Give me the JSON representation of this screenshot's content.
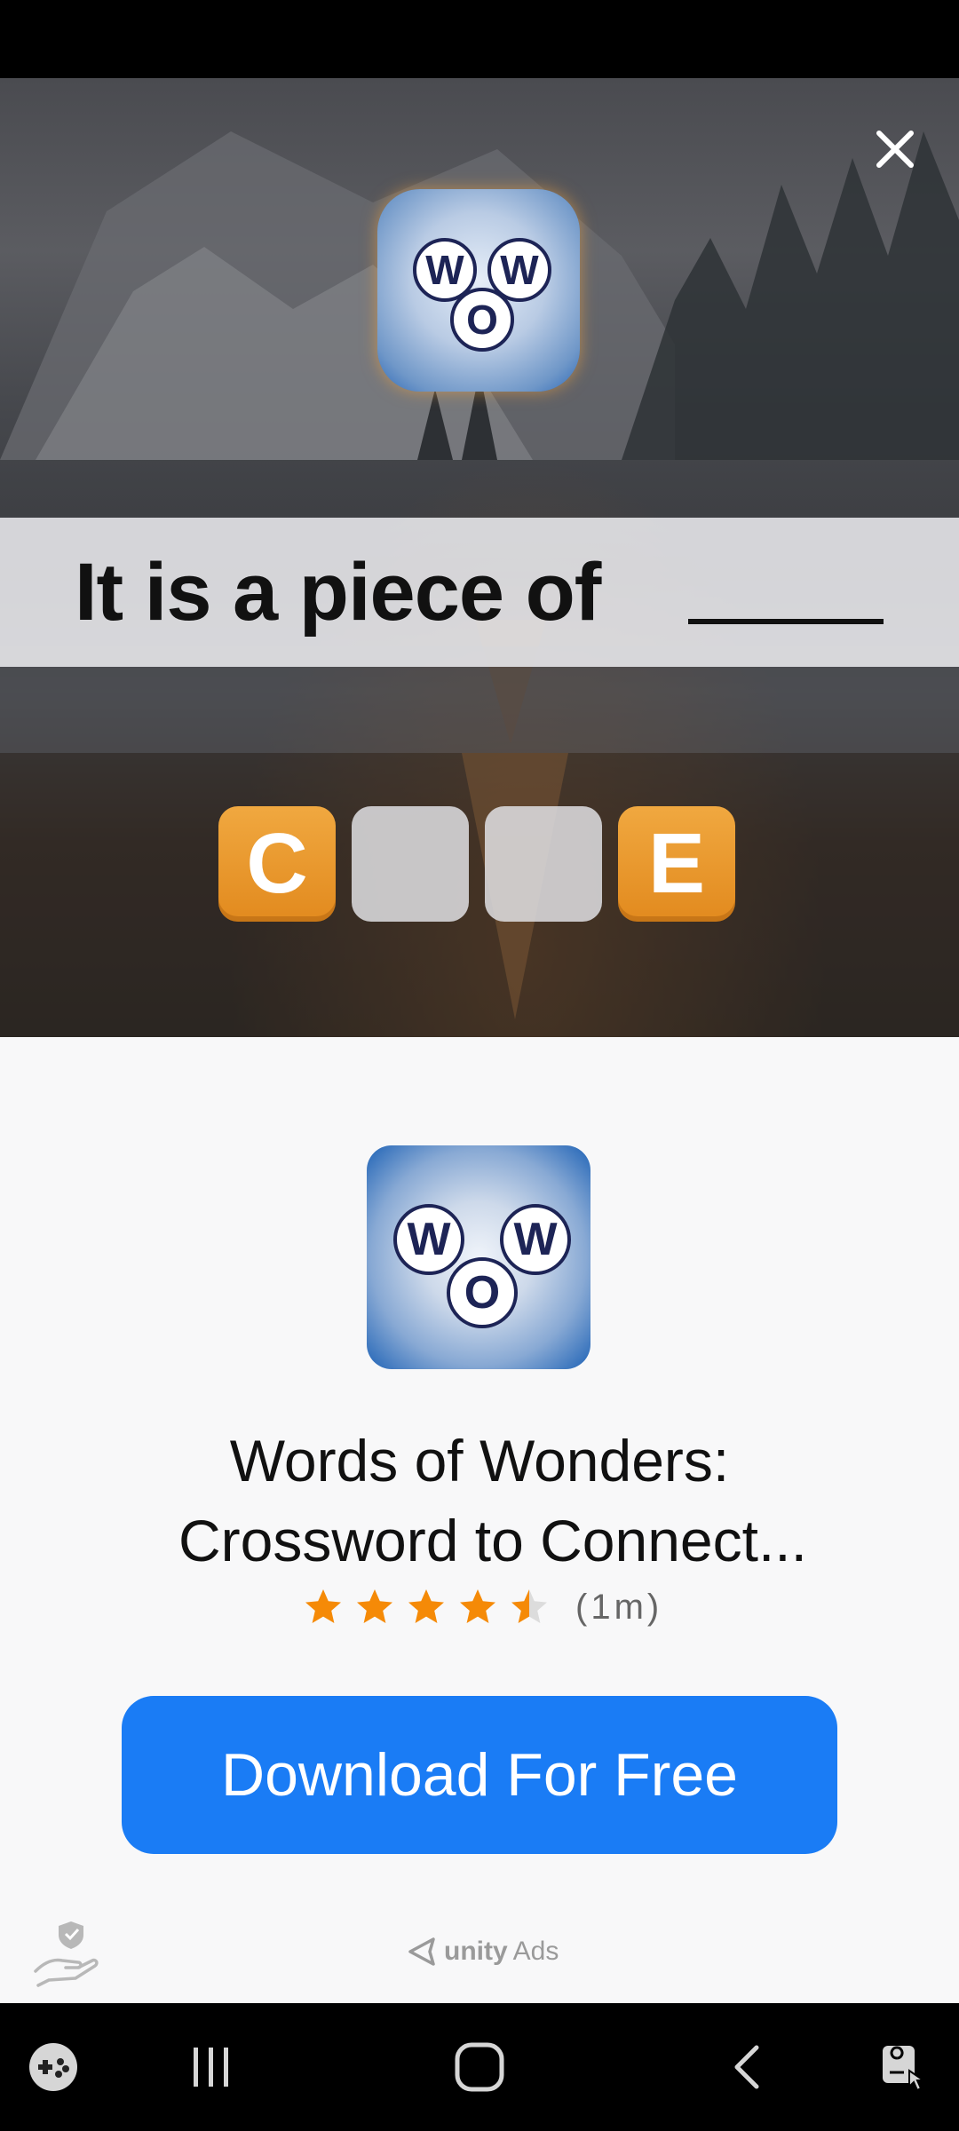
{
  "ad": {
    "question": "It is a piece of",
    "tiles": [
      "C",
      "",
      "",
      "E"
    ],
    "logo_letters": {
      "left": "W",
      "right": "W",
      "bottom": "O"
    }
  },
  "app": {
    "title_line1": "Words of Wonders:",
    "title_line2": "Crossword to Connect...",
    "rating": 4.5,
    "rating_count": "(1m)",
    "download_label": "Download For Free",
    "ad_network_word": "unity",
    "ad_network_suffix": "Ads"
  },
  "icons": {
    "close": "close-icon",
    "privacy": "privacy-hand-shield-icon",
    "game_launcher": "game-launcher-icon",
    "recents": "recents-icon",
    "home": "home-icon",
    "back": "back-icon",
    "screen_assist": "screen-assist-icon"
  },
  "colors": {
    "accent": "#1a7cf5",
    "tile_orange": "#e8951f",
    "star": "#f58a07",
    "logo_navy": "#1d2456"
  }
}
